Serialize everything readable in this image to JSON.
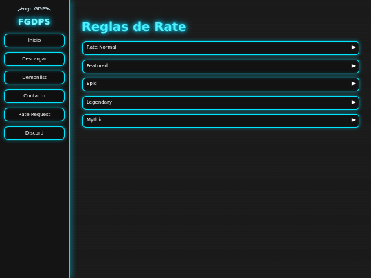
{
  "sidebar": {
    "logo_alt": "Logo GDPS",
    "brand": "FGDPS",
    "items": [
      {
        "label": "Inicio"
      },
      {
        "label": "Descargar"
      },
      {
        "label": "Demonlist"
      },
      {
        "label": "Contacto"
      },
      {
        "label": "Rate Request"
      },
      {
        "label": "Discord"
      }
    ]
  },
  "main": {
    "title": "Reglas de Rate",
    "rules": [
      {
        "label": "Rate Normal"
      },
      {
        "label": "Featured"
      },
      {
        "label": "Epic"
      },
      {
        "label": "Legendary"
      },
      {
        "label": "Mythic"
      }
    ],
    "arrow_glyph": "▶"
  },
  "colors": {
    "accent": "#00e5ff",
    "background": "#1a1a1a",
    "sidebar_background": "#141414",
    "text": "#ffffff"
  },
  "icons": {
    "logo": "broken-image-logo",
    "row_expand": "play-triangle-icon"
  }
}
